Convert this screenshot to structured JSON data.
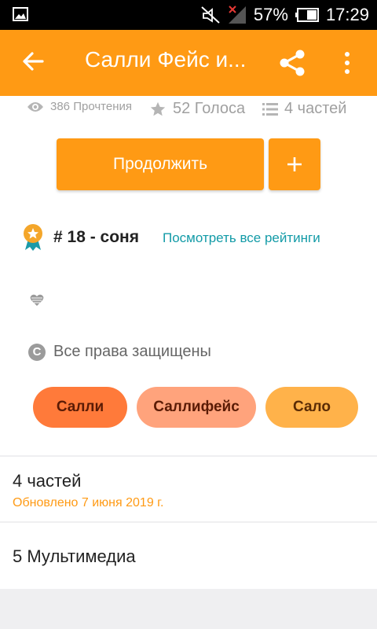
{
  "status_bar": {
    "battery_percent": "57%",
    "time": "17:29",
    "icons": [
      "gallery-icon",
      "muted-icon",
      "no-signal-icon",
      "battery-icon"
    ]
  },
  "app_bar": {
    "title": "Салли Фейс и...",
    "icons": [
      "back-arrow-icon",
      "share-icon",
      "more-vert-icon"
    ]
  },
  "stats": {
    "reads": "386 Прочтения",
    "votes": "52 Голоса",
    "parts": "4 частей"
  },
  "actions": {
    "continue_label": "Продолжить",
    "add_icon": "plus-icon"
  },
  "ranking": {
    "text": "# 18 - соня",
    "link": "Посмотреть все рейтинги"
  },
  "copyright": "Все права защищены",
  "tags": [
    "Салли",
    "Саллифейс",
    "Сало"
  ],
  "parts_section": {
    "title": "4 частей",
    "updated": "Обновлено 7 июня 2019 г."
  },
  "media_section": {
    "title": "5 Мультимедиа"
  },
  "colors": {
    "accent": "#ff9a14",
    "link": "#139ba7",
    "tag1": "#ff7a3a",
    "tag2": "#ffa37c",
    "tag3": "#ffb24a"
  }
}
